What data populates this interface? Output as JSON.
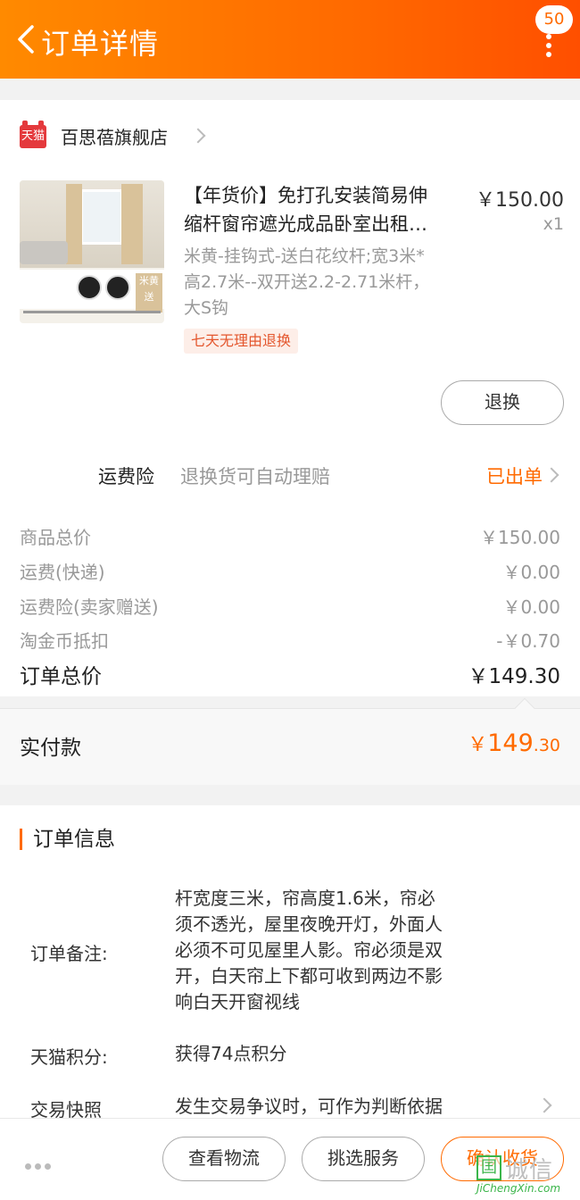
{
  "header": {
    "title": "订单详情",
    "badge_count": "50"
  },
  "store": {
    "name": "百思蓓旗舰店",
    "logo_text": "天猫"
  },
  "product": {
    "title_line1": "【年货价】免打孔安装简易伸",
    "title_line2": "缩杆窗帘遮光成品卧室出租…",
    "price": "￥150.00",
    "qty": "x1",
    "sku_line1": "米黄-挂钩式-送白花纹杆;宽3米*",
    "sku_line2": "高2.7米--双开送2.2-2.71米杆，",
    "sku_line3": "大S钩",
    "return_tag": "七天无理由退换",
    "image_tag": "米黄 送"
  },
  "actions": {
    "exchange": "退换"
  },
  "insurance": {
    "label": "运费险",
    "desc": "退换货可自动理赔",
    "status": "已出单"
  },
  "fees": [
    {
      "label": "商品总价",
      "value": "￥150.00"
    },
    {
      "label": "运费(快递)",
      "value": "￥0.00"
    },
    {
      "label": "运费险(卖家赠送)",
      "value": "￥0.00"
    },
    {
      "label": "淘金币抵扣",
      "value": "-￥0.70"
    }
  ],
  "total": {
    "label": "订单总价",
    "value": "￥149.30"
  },
  "paid": {
    "label": "实付款",
    "symbol": "￥",
    "int": "149",
    "dec": ".30"
  },
  "order_info": {
    "title": "订单信息",
    "note_label": "订单备注:",
    "note_lines": [
      "杆宽度三米，帘高度1.6米，帘必",
      "须不透光，屋里夜晚开灯，外面人",
      "必须不可见屋里人影。帘必须是双",
      "开，白天帘上下都可收到两边不影",
      "响白天开窗视线"
    ],
    "points_label": "天猫积分:",
    "points_value": "获得74点积分",
    "snapshot_label": "交易快照",
    "snapshot_value": "发生交易争议时，可作为判断依据"
  },
  "bottom": {
    "logistics": "查看物流",
    "service": "挑选服务",
    "confirm": "确认收货"
  },
  "watermark": {
    "box": "囯",
    "text": "诚信",
    "sub": "JiChengXin.com"
  },
  "colors": {
    "accent": "#ff6a00",
    "tmall_red": "#e4393c"
  }
}
